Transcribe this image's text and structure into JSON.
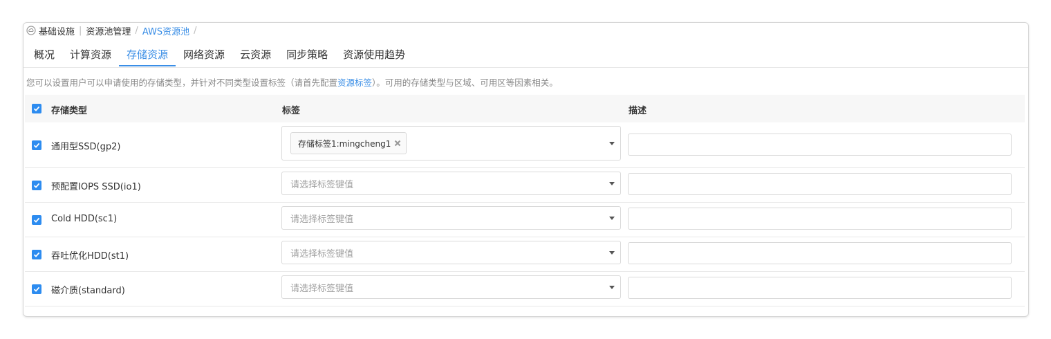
{
  "breadcrumb": {
    "home": "基础设施",
    "middle": "资源池管理",
    "current": "AWS资源池",
    "sep": "|",
    "slash": "/"
  },
  "tabs": [
    {
      "label": "概况"
    },
    {
      "label": "计算资源"
    },
    {
      "label": "存储资源",
      "active": true
    },
    {
      "label": "网络资源"
    },
    {
      "label": "云资源"
    },
    {
      "label": "同步策略"
    },
    {
      "label": "资源使用趋势"
    }
  ],
  "intro": {
    "before": "您可以设置用户可以申请使用的存储类型，并针对不同类型设置标签（请首先配置",
    "link": "资源标签",
    "after": "）。可用的存储类型与区域、可用区等因素相关。"
  },
  "table": {
    "headers": {
      "type": "存储类型",
      "tag": "标签",
      "desc": "描述"
    },
    "rows": [
      {
        "type": "通用型SSD(gp2)",
        "tag_chip": "存储标签1:mingcheng1",
        "tag_placeholder": "",
        "checked": true
      },
      {
        "type": "预配置IOPS SSD(io1)",
        "tag_placeholder": "请选择标签键值",
        "checked": true
      },
      {
        "type": "Cold HDD(sc1)",
        "tag_placeholder": "请选择标签键值",
        "checked": true
      },
      {
        "type": "吞吐优化HDD(st1)",
        "tag_placeholder": "请选择标签键值",
        "checked": true
      },
      {
        "type": "磁介质(standard)",
        "tag_placeholder": "请选择标签键值",
        "checked": true
      }
    ]
  },
  "colors": {
    "accent": "#3a8ee6",
    "checkbox": "#2d8cf0"
  },
  "icons": {
    "home": "cloud-icon",
    "chip_remove": "close-icon",
    "dropdown": "caret-down-icon",
    "check": "check-icon"
  }
}
